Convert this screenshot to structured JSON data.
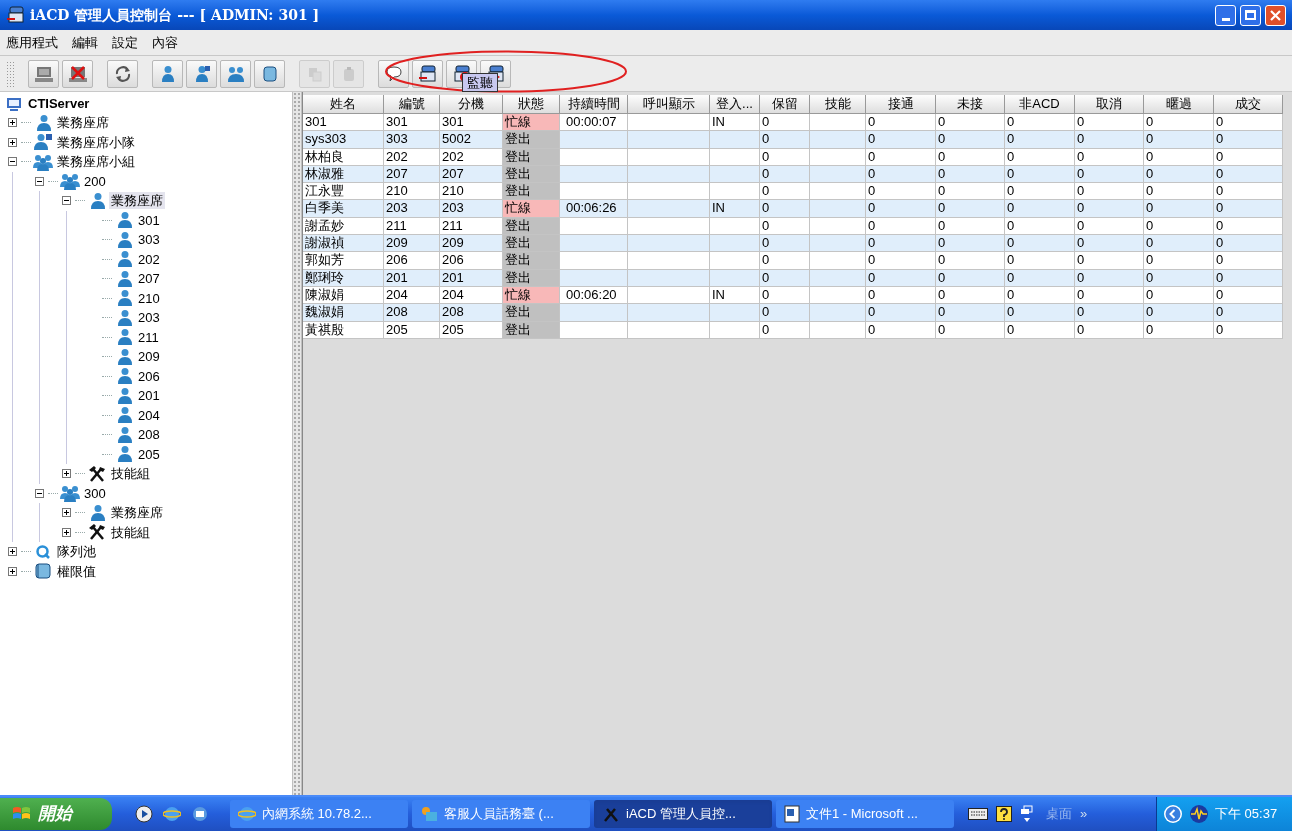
{
  "window": {
    "title": "iACD 管理人員控制台 --- [ ADMIN: 301 ]"
  },
  "menu": [
    "應用程式",
    "編輯",
    "設定",
    "內容"
  ],
  "toolbar": [
    [
      {
        "kind": "computer",
        "disabled": false
      },
      {
        "kind": "computer-x",
        "disabled": false
      }
    ],
    [
      {
        "kind": "refresh",
        "disabled": false
      }
    ],
    [
      {
        "kind": "person",
        "disabled": false
      },
      {
        "kind": "team",
        "disabled": false
      },
      {
        "kind": "group",
        "disabled": false
      },
      {
        "kind": "book",
        "disabled": false
      }
    ],
    [
      {
        "kind": "copy",
        "disabled": true
      },
      {
        "kind": "paste",
        "disabled": true
      }
    ],
    [
      {
        "kind": "bubble",
        "disabled": false
      },
      {
        "kind": "phone",
        "disabled": false
      },
      {
        "kind": "phone-block",
        "disabled": false
      },
      {
        "kind": "phone-arrow",
        "disabled": false
      }
    ]
  ],
  "tooltip": "監聽",
  "tree": {
    "label": "CTIServer",
    "kind": "computer",
    "selected": false,
    "children": [
      {
        "label": "業務座席",
        "kind": "person",
        "expanded": false,
        "selected": false
      },
      {
        "label": "業務座席小隊",
        "kind": "team",
        "expanded": false,
        "selected": false
      },
      {
        "label": "業務座席小組",
        "kind": "group",
        "expanded": true,
        "selected": false,
        "children": [
          {
            "label": "200",
            "kind": "group",
            "expanded": true,
            "selected": false,
            "children": [
              {
                "label": "業務座席",
                "kind": "person",
                "expanded": true,
                "selected": true,
                "children": [
                  {
                    "label": "301",
                    "kind": "person",
                    "selected": false
                  },
                  {
                    "label": "303",
                    "kind": "person",
                    "selected": false
                  },
                  {
                    "label": "202",
                    "kind": "person",
                    "selected": false
                  },
                  {
                    "label": "207",
                    "kind": "person",
                    "selected": false
                  },
                  {
                    "label": "210",
                    "kind": "person",
                    "selected": false
                  },
                  {
                    "label": "203",
                    "kind": "person",
                    "selected": false
                  },
                  {
                    "label": "211",
                    "kind": "person",
                    "selected": false
                  },
                  {
                    "label": "209",
                    "kind": "person",
                    "selected": false
                  },
                  {
                    "label": "206",
                    "kind": "person",
                    "selected": false
                  },
                  {
                    "label": "201",
                    "kind": "person",
                    "selected": false
                  },
                  {
                    "label": "204",
                    "kind": "person",
                    "selected": false
                  },
                  {
                    "label": "208",
                    "kind": "person",
                    "selected": false
                  },
                  {
                    "label": "205",
                    "kind": "person",
                    "selected": false
                  }
                ]
              },
              {
                "label": "技能組",
                "kind": "tools",
                "expanded": false,
                "selected": false
              }
            ]
          },
          {
            "label": "300",
            "kind": "group",
            "expanded": true,
            "selected": false,
            "children": [
              {
                "label": "業務座席",
                "kind": "person",
                "expanded": false,
                "selected": false
              },
              {
                "label": "技能組",
                "kind": "tools",
                "expanded": false,
                "selected": false
              }
            ]
          }
        ]
      },
      {
        "label": "隊列池",
        "kind": "queue",
        "expanded": false,
        "selected": false
      },
      {
        "label": "權限值",
        "kind": "book",
        "expanded": false,
        "selected": false
      }
    ]
  },
  "table": {
    "columns": [
      "姓名",
      "編號",
      "分機",
      "狀態",
      "持續時間",
      "呼叫顯示",
      "登入...",
      "保留",
      "技能",
      "接通",
      "未接",
      "非ACD",
      "取消",
      "暱過",
      "成交"
    ],
    "rows": [
      {
        "busy": true,
        "cells": [
          "301",
          "301",
          "301",
          "忙線",
          "00:00:07",
          "",
          "IN",
          "0",
          "",
          "0",
          "0",
          "0",
          "0",
          "0",
          "0"
        ]
      },
      {
        "busy": false,
        "cells": [
          "sys303",
          "303",
          "5002",
          "登出",
          "",
          "",
          "",
          "0",
          "",
          "0",
          "0",
          "0",
          "0",
          "0",
          "0"
        ]
      },
      {
        "busy": false,
        "cells": [
          "林柏良",
          "202",
          "202",
          "登出",
          "",
          "",
          "",
          "0",
          "",
          "0",
          "0",
          "0",
          "0",
          "0",
          "0"
        ]
      },
      {
        "busy": false,
        "cells": [
          "林淑雅",
          "207",
          "207",
          "登出",
          "",
          "",
          "",
          "0",
          "",
          "0",
          "0",
          "0",
          "0",
          "0",
          "0"
        ]
      },
      {
        "busy": false,
        "cells": [
          "江永豐",
          "210",
          "210",
          "登出",
          "",
          "",
          "",
          "0",
          "",
          "0",
          "0",
          "0",
          "0",
          "0",
          "0"
        ]
      },
      {
        "busy": true,
        "cells": [
          "白季美",
          "203",
          "203",
          "忙線",
          "00:06:26",
          "",
          "IN",
          "0",
          "",
          "0",
          "0",
          "0",
          "0",
          "0",
          "0"
        ]
      },
      {
        "busy": false,
        "cells": [
          "謝孟妙",
          "211",
          "211",
          "登出",
          "",
          "",
          "",
          "0",
          "",
          "0",
          "0",
          "0",
          "0",
          "0",
          "0"
        ]
      },
      {
        "busy": false,
        "cells": [
          "謝淑禎",
          "209",
          "209",
          "登出",
          "",
          "",
          "",
          "0",
          "",
          "0",
          "0",
          "0",
          "0",
          "0",
          "0"
        ]
      },
      {
        "busy": false,
        "cells": [
          "郭如芳",
          "206",
          "206",
          "登出",
          "",
          "",
          "",
          "0",
          "",
          "0",
          "0",
          "0",
          "0",
          "0",
          "0"
        ]
      },
      {
        "busy": false,
        "cells": [
          "鄭琍玲",
          "201",
          "201",
          "登出",
          "",
          "",
          "",
          "0",
          "",
          "0",
          "0",
          "0",
          "0",
          "0",
          "0"
        ]
      },
      {
        "busy": true,
        "cells": [
          "陳淑娟",
          "204",
          "204",
          "忙線",
          "00:06:20",
          "",
          "IN",
          "0",
          "",
          "0",
          "0",
          "0",
          "0",
          "0",
          "0"
        ]
      },
      {
        "busy": false,
        "cells": [
          "魏淑娟",
          "208",
          "208",
          "登出",
          "",
          "",
          "",
          "0",
          "",
          "0",
          "0",
          "0",
          "0",
          "0",
          "0"
        ]
      },
      {
        "busy": false,
        "cells": [
          "黃祺殷",
          "205",
          "205",
          "登出",
          "",
          "",
          "",
          "0",
          "",
          "0",
          "0",
          "0",
          "0",
          "0",
          "0"
        ]
      }
    ]
  },
  "taskbar": {
    "start": "開始",
    "quick_launch": [
      {
        "kind": "media"
      },
      {
        "kind": "browser"
      },
      {
        "kind": "email"
      }
    ],
    "tasks": [
      {
        "label": "內網系統 10.78.2...",
        "kind": "browser",
        "selected": false
      },
      {
        "label": "客服人員話務臺 (...",
        "kind": "app",
        "selected": false
      },
      {
        "label": "iACD 管理人員控...",
        "kind": "tools",
        "selected": true
      },
      {
        "label": "文件1 - Microsoft ...",
        "kind": "doc",
        "selected": false
      }
    ],
    "desktop": "桌面",
    "chevron": "»",
    "clock": "下午 05:37"
  }
}
